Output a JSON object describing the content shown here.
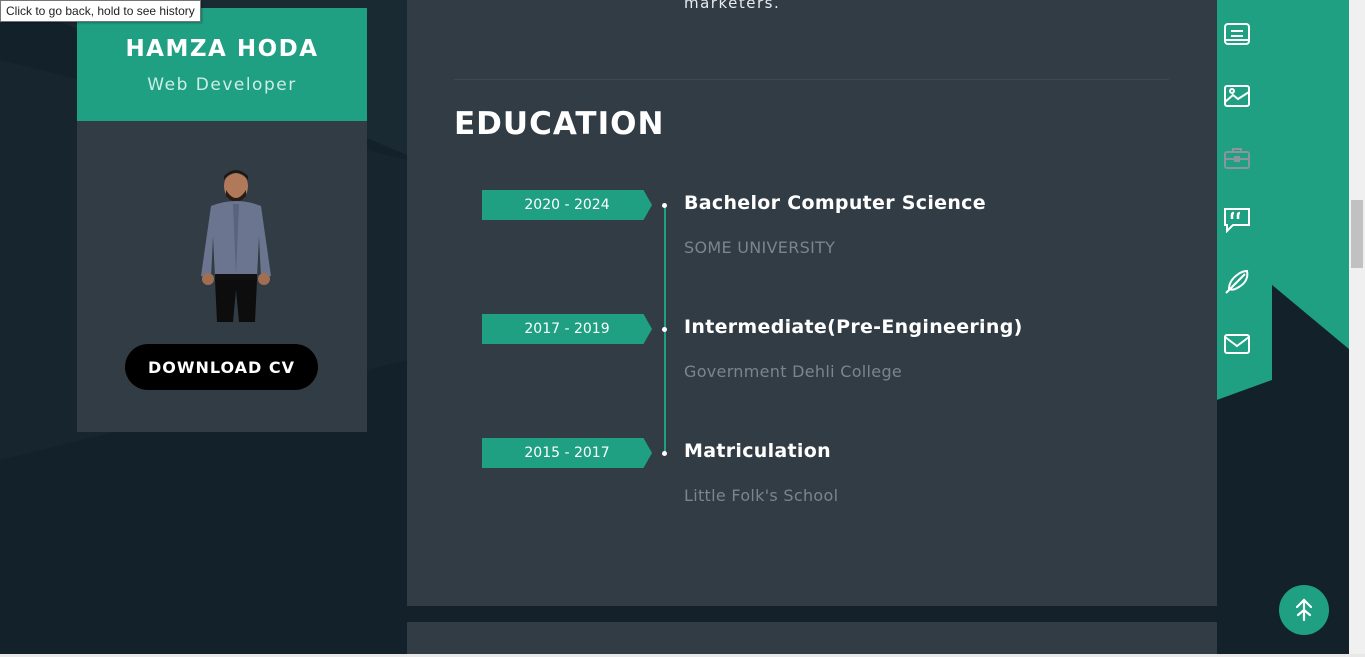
{
  "tooltip": "Click to go back, hold to see history",
  "profile": {
    "name": "HAMZA HODA",
    "role": "Web Developer",
    "download_label": "DOWNLOAD CV"
  },
  "previous_text": "marketers.",
  "education": {
    "title": "EDUCATION",
    "items": [
      {
        "date": "2020 - 2024",
        "title": "Bachelor Computer Science",
        "school": "SOME UNIVERSITY"
      },
      {
        "date": "2017 - 2019",
        "title": "Intermediate(Pre-Engineering)",
        "school": "Government Dehli College"
      },
      {
        "date": "2015 - 2017",
        "title": "Matriculation",
        "school": "Little Folk's School"
      }
    ]
  },
  "nav_icons": [
    "resume-icon",
    "portfolio-icon",
    "briefcase-icon",
    "testimonial-icon",
    "blog-feather-icon",
    "mail-icon"
  ],
  "colors": {
    "accent": "#1fa083",
    "panel": "#323c44",
    "background": "#13222a"
  }
}
